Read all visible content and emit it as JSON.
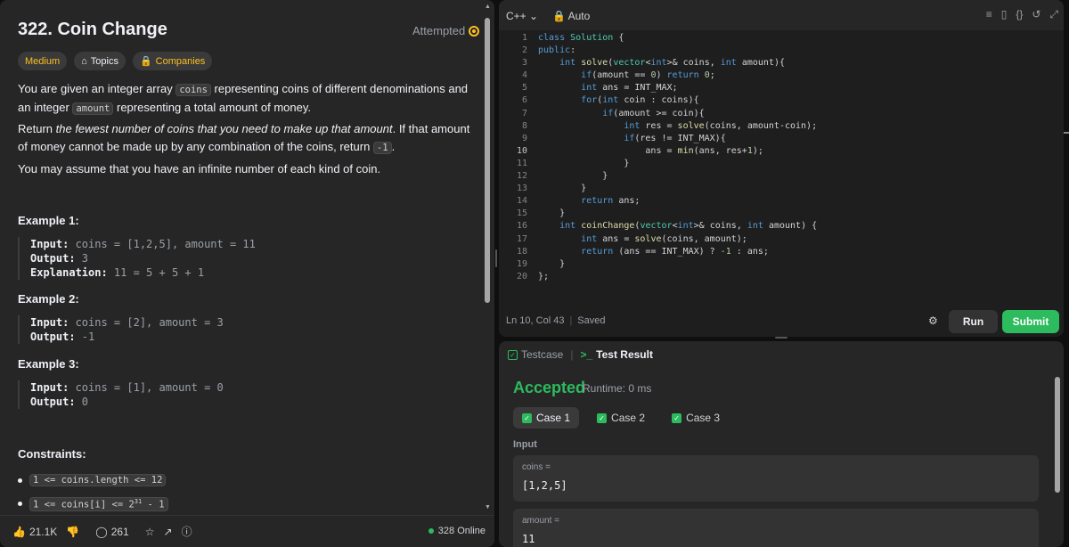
{
  "problem": {
    "title": "322. Coin Change",
    "status": "Attempted",
    "tags": {
      "difficulty": "Medium",
      "topics": "Topics",
      "companies": "Companies"
    },
    "desc1_a": "You are given an integer array ",
    "desc1_code1": "coins",
    "desc1_b": " representing coins of different denominations and an integer ",
    "desc1_code2": "amount",
    "desc1_c": " representing a total amount of money.",
    "desc2_a": "Return ",
    "desc2_em": "the fewest number of coins that you need to make up that amount",
    "desc2_b": ". If that amount of money cannot be made up by any combination of the coins, return ",
    "desc2_code": "-1",
    "desc2_c": ".",
    "desc3": "You may assume that you have an infinite number of each kind of coin.",
    "examples": [
      {
        "title": "Example 1:",
        "input_label": "Input:",
        "input": " coins = [1,2,5], amount = 11",
        "output_label": "Output:",
        "output": " 3",
        "expl_label": "Explanation:",
        "expl": " 11 = 5 + 5 + 1"
      },
      {
        "title": "Example 2:",
        "input_label": "Input:",
        "input": " coins = [2], amount = 3",
        "output_label": "Output:",
        "output": " -1"
      },
      {
        "title": "Example 3:",
        "input_label": "Input:",
        "input": " coins = [1], amount = 0",
        "output_label": "Output:",
        "output": " 0"
      }
    ],
    "constraints_title": "Constraints:",
    "constraints": [
      "1 <= coins.length <= 12",
      "1 <= coins[i] <= 2",
      "31",
      " - 1"
    ]
  },
  "footer": {
    "likes": "21.1K",
    "comments": "261",
    "online": "328 Online"
  },
  "editor": {
    "language": "C++",
    "mode": "Auto",
    "status_pos": "Ln 10, Col 43",
    "status_saved": "Saved",
    "run_label": "Run",
    "submit_label": "Submit"
  },
  "result": {
    "tab_testcase": "Testcase",
    "tab_result": "Test Result",
    "verdict": "Accepted",
    "runtime": "Runtime: 0 ms",
    "cases": [
      "Case 1",
      "Case 2",
      "Case 3"
    ],
    "input_label": "Input",
    "params": [
      {
        "name": "coins =",
        "value": "[1,2,5]"
      },
      {
        "name": "amount =",
        "value": "11"
      }
    ]
  },
  "colors": {
    "accent_green": "#2cbb5d",
    "medium_yellow": "#ffc01e",
    "panel_bg": "#262626",
    "editor_bg": "#1e1e1e"
  }
}
